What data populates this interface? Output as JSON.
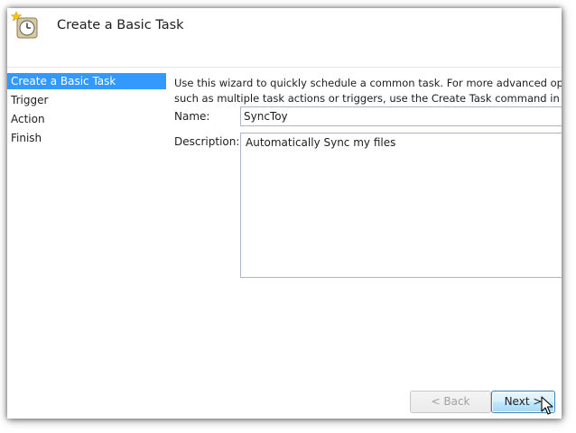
{
  "header": {
    "title": "Create a Basic Task",
    "icon": "task-scheduler-clock-icon"
  },
  "steps": [
    {
      "label": "Create a Basic Task",
      "active": true
    },
    {
      "label": "Trigger",
      "active": false
    },
    {
      "label": "Action",
      "active": false
    },
    {
      "label": "Finish",
      "active": false
    }
  ],
  "intro": {
    "line1": "Use this wizard to quickly schedule a common task.  For more advanced options o",
    "line2": "such as multiple task actions or triggers, use the Create Task command in the Act"
  },
  "form": {
    "name_label": "Name:",
    "name_value": "SyncToy",
    "description_label": "Description:",
    "description_value": "Automatically Sync my files"
  },
  "buttons": {
    "back_label": "< Back",
    "next_label": "Next >"
  },
  "colors": {
    "selection": "#3399ff",
    "input_border": "#a8b8cc",
    "next_button_border": "#3c7fb1"
  }
}
